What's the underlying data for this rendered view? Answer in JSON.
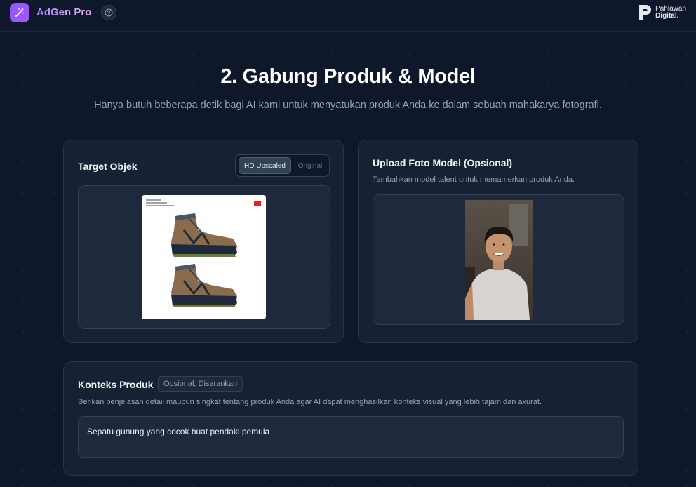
{
  "header": {
    "app_title": "AdGen Pro",
    "logo_icon": "magic-wand-icon",
    "help_icon": "help-circle-icon",
    "brand_line1": "Pahlawan",
    "brand_line2": "Digital."
  },
  "page": {
    "title": "2. Gabung Produk & Model",
    "subtitle": "Hanya butuh beberapa detik bagi AI kami untuk menyatukan produk Anda ke dalam sebuah mahakarya fotografi."
  },
  "target_card": {
    "title": "Target Objek",
    "toggle_options": [
      "HD Upscaled",
      "Original"
    ],
    "toggle_selected": "HD Upscaled"
  },
  "model_card": {
    "title": "Upload Foto Model (Opsional)",
    "description": "Tambahkan model talent untuk memamerkan produk Anda."
  },
  "context_card": {
    "title": "Konteks Produk",
    "badge": "Opsional, Disarankan",
    "description": "Berikan penjelasan detail maupun singkat tentang produk Anda agar AI dapat menghasilkan konteks visual yang lebih tajam dan akurat.",
    "value": "Sepatu gunung yang cocok buat pendaki pemula"
  },
  "colors": {
    "background": "#0f172a",
    "card": "#1e293b",
    "accent": "#8b5cf6"
  }
}
